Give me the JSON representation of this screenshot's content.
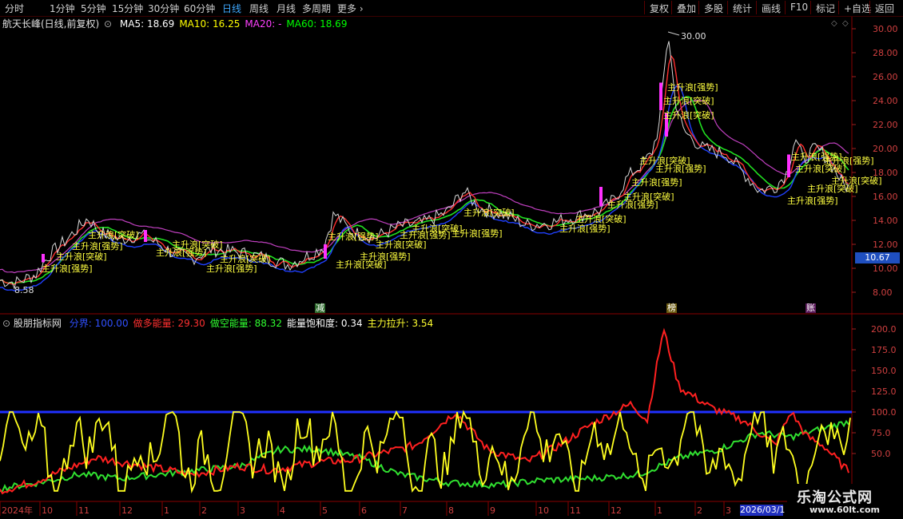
{
  "toolbar": {
    "timeframes": [
      "分时",
      "1分钟",
      "5分钟",
      "15分钟",
      "30分钟",
      "60分钟",
      "日线",
      "周线",
      "月线",
      "多周期",
      "更多"
    ],
    "active": "日线",
    "more_arrow": "›",
    "right_buttons": [
      "复权",
      "叠加",
      "多股",
      "统计",
      "画线",
      "F10",
      "标记",
      "+自选",
      "返回"
    ]
  },
  "stock": {
    "title": "航天长峰(日线,前复权)",
    "ma": [
      {
        "label": "MA5: 18.69",
        "color": "#ffffff"
      },
      {
        "label": "MA10: 16.25",
        "color": "#ffff00"
      },
      {
        "label": "MA20: -",
        "color": "#ff40ff"
      },
      {
        "label": "MA60: 18.69",
        "color": "#00ff00"
      }
    ],
    "high_label": "30.00",
    "low_label": "8.58",
    "last_price": "10.67",
    "price_ticks": [
      "30.00",
      "28.00",
      "26.00",
      "24.00",
      "22.00",
      "20.00",
      "18.00",
      "16.00",
      "14.00",
      "12.00",
      "10.00",
      "8.00"
    ],
    "markers": [
      {
        "text": "减",
        "bg": "#2e6b2e"
      },
      {
        "text": "榜",
        "bg": "#6b5a10"
      },
      {
        "text": "账",
        "bg": "#5a1a5a"
      }
    ],
    "annotation_label": "主升浪[强势]",
    "annotation_label2": "主升浪[突破]"
  },
  "indicator": {
    "name": "股朋指标网",
    "values": [
      {
        "label": "分界: 100.00",
        "color": "#3050ff"
      },
      {
        "label": "做多能量: 29.30",
        "color": "#ff3030"
      },
      {
        "label": "做空能量: 88.32",
        "color": "#30ff30"
      },
      {
        "label": "能量饱和度: 0.34",
        "color": "#ffffff"
      },
      {
        "label": "主力拉升: 3.54",
        "color": "#ffff30"
      }
    ],
    "ticks": [
      "200.0",
      "175.0",
      "150.0",
      "125.0",
      "100.0",
      "75.0",
      "50.0"
    ]
  },
  "date_axis": {
    "labels": [
      "2024年",
      "10",
      "11",
      "12",
      "1",
      "2",
      "3",
      "4",
      "5",
      "6",
      "7",
      "8",
      "9",
      "10",
      "11",
      "12",
      "1",
      "2",
      "3"
    ],
    "highlight": "2026/03/1"
  },
  "brand": {
    "name": "乐淘公式网",
    "url": "www.60lt.com"
  }
}
